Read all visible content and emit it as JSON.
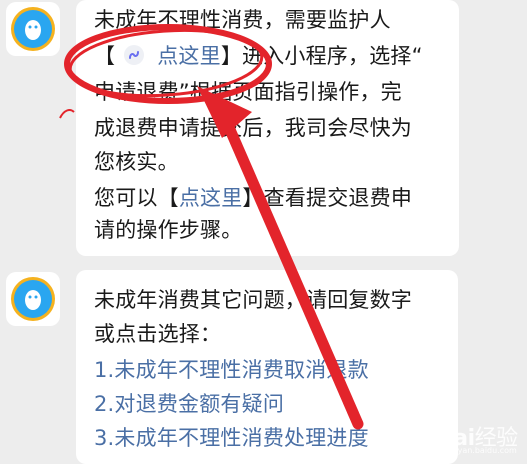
{
  "messages": [
    {
      "lines": [
        {
          "a": "未成年不理性消费，需要监护人"
        },
        {
          "a": "【",
          "link": "点这里",
          "b": "】进入小程序，选择“"
        },
        {
          "a": "申请退费”根据页面指引操作，完"
        },
        {
          "a": "成退费申请提交后，我司会尽快为"
        },
        {
          "a": "您核实。"
        },
        {
          "a": "您可以【",
          "link": "点这里",
          "b": "】查看提交退费申"
        },
        {
          "a": "请的操作步骤。"
        }
      ]
    },
    {
      "intro": [
        "未成年消费其它问题，请回复数字",
        "或点击选择："
      ],
      "options": [
        "1.未成年不理性消费取消退款",
        "2.对退费金额有疑问",
        "3.未成年不理性消费处理进度"
      ]
    }
  ],
  "icons": {
    "avatar": "qq-penguin-chat-icon",
    "mini_program": "mini-program-icon"
  },
  "colors": {
    "background": "#ededed",
    "bubble": "#ffffff",
    "link": "#4a6fa5",
    "annotation": "#e3242b"
  }
}
